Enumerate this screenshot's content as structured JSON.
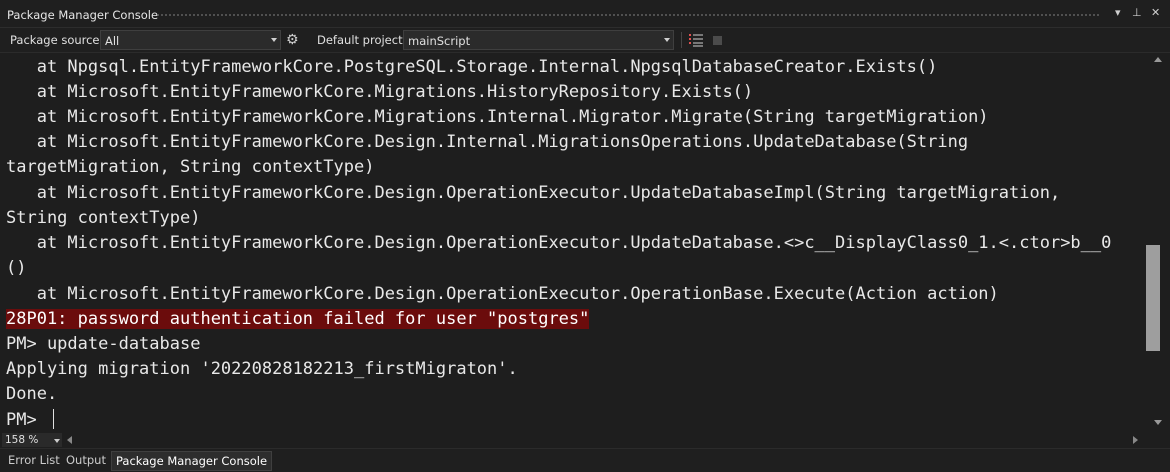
{
  "window": {
    "title": "Package Manager Console",
    "controls": {
      "dropdown": "▾",
      "pin": "⊥",
      "close": "✕"
    }
  },
  "toolbar": {
    "package_source_label": "Package source:",
    "package_source_value": "All",
    "default_project_label": "Default project:",
    "default_project_value": "mainScript",
    "icons": [
      "gear-icon",
      "clear-console-icon",
      "stop-icon"
    ]
  },
  "console": {
    "lines": [
      "   at Npgsql.EntityFrameworkCore.PostgreSQL.Storage.Internal.NpgsqlDatabaseCreator.Exists()",
      "   at Microsoft.EntityFrameworkCore.Migrations.HistoryRepository.Exists()",
      "   at Microsoft.EntityFrameworkCore.Migrations.Internal.Migrator.Migrate(String targetMigration)",
      "   at Microsoft.EntityFrameworkCore.Design.Internal.MigrationsOperations.UpdateDatabase(String",
      "targetMigration, String contextType)",
      "   at Microsoft.EntityFrameworkCore.Design.OperationExecutor.UpdateDatabaseImpl(String targetMigration,",
      "String contextType)",
      "   at Microsoft.EntityFrameworkCore.Design.OperationExecutor.UpdateDatabase.<>c__DisplayClass0_1.<.ctor>b__0",
      "()",
      "   at Microsoft.EntityFrameworkCore.Design.OperationExecutor.OperationBase.Execute(Action action)"
    ],
    "error_line": "28P01: password authentication failed for user \"postgres\"",
    "after_lines": [
      "PM> update-database",
      "Applying migration '20220828182213_firstMigraton'.",
      "Done."
    ],
    "prompt": "PM> "
  },
  "status": {
    "zoom": "158 %"
  },
  "tabs": [
    {
      "label": "Error List",
      "active": false
    },
    {
      "label": "Output",
      "active": false
    },
    {
      "label": "Package Manager Console",
      "active": true
    }
  ],
  "colors": {
    "background": "#1e1e1e",
    "error_highlight": "#6b0c0c",
    "text": "#e8e8e8"
  }
}
